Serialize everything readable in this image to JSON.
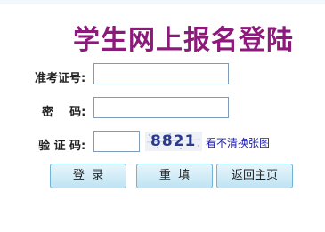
{
  "page": {
    "title": "学生网上报名登陆"
  },
  "form": {
    "exam_no_label": "准考证号:",
    "password_label": "密    码:",
    "captcha_label": "验 证 码:",
    "exam_no_value": "",
    "password_value": "",
    "captcha_value": "",
    "captcha_image_text": "8821",
    "refresh_captcha_text": "看不清换张图"
  },
  "buttons": {
    "login": "登  录",
    "reset": "重  填",
    "home": "返回主页"
  },
  "colors": {
    "title": "#8b1a7a",
    "link": "#1a1aa6",
    "button_border": "#6fb3d6"
  }
}
